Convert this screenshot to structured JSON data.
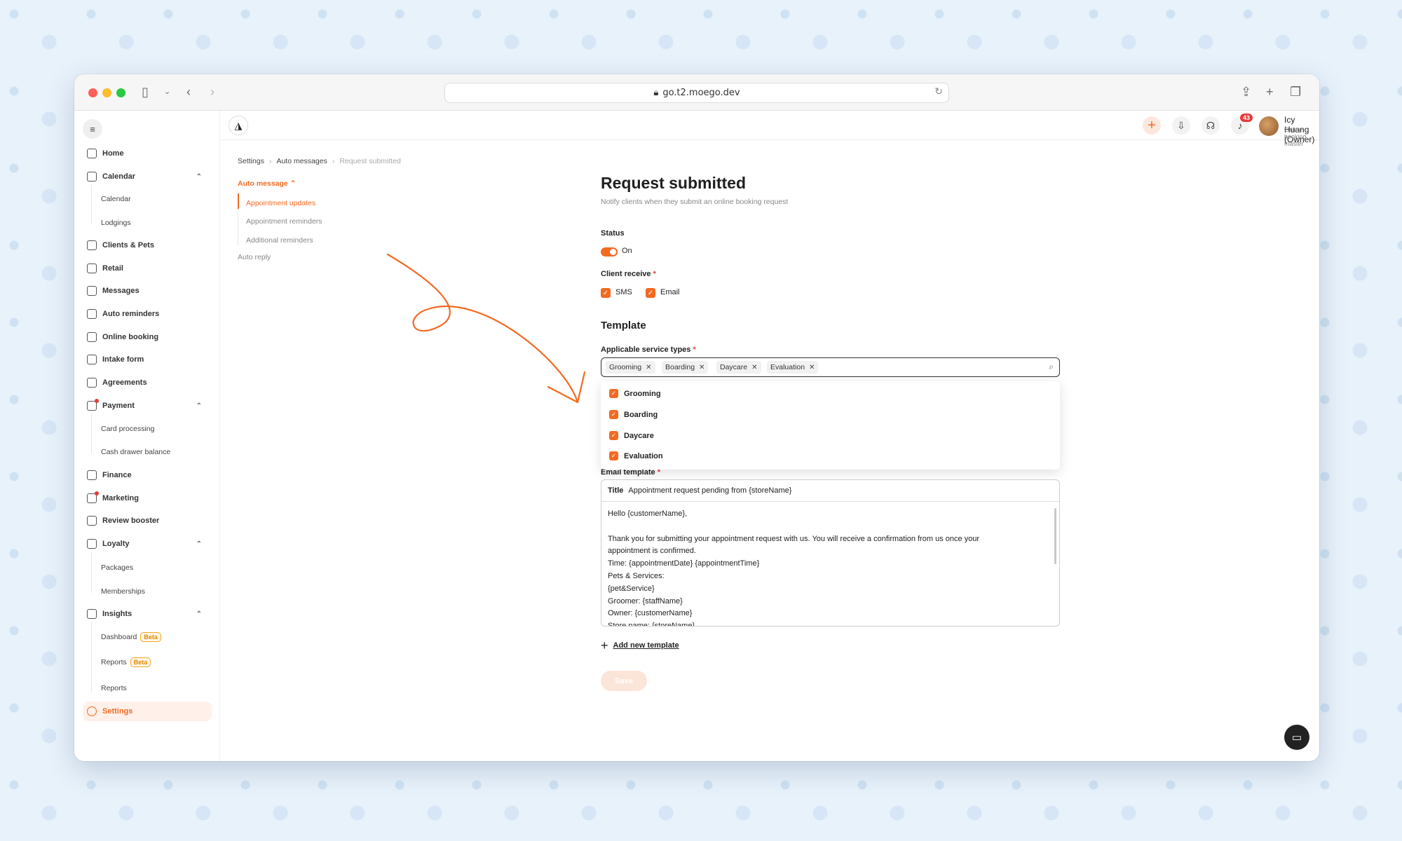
{
  "browser": {
    "url": "go.t2.moego.dev"
  },
  "header": {
    "notifications_count": "43",
    "user_name": "Icy Huang (Owner)",
    "user_role": "Online booking master"
  },
  "sidebar": {
    "items": [
      {
        "label": "Home"
      },
      {
        "label": "Calendar"
      },
      {
        "label": "Clients & Pets"
      },
      {
        "label": "Retail"
      },
      {
        "label": "Messages"
      },
      {
        "label": "Auto reminders"
      },
      {
        "label": "Online booking"
      },
      {
        "label": "Intake form"
      },
      {
        "label": "Agreements"
      },
      {
        "label": "Payment"
      },
      {
        "label": "Finance"
      },
      {
        "label": "Marketing"
      },
      {
        "label": "Review booster"
      },
      {
        "label": "Loyalty"
      },
      {
        "label": "Insights"
      },
      {
        "label": "Settings"
      }
    ],
    "calendar_sub": [
      "Calendar",
      "Lodgings"
    ],
    "payment_sub": [
      "Card processing",
      "Cash drawer balance"
    ],
    "loyalty_sub": [
      "Packages",
      "Memberships"
    ],
    "insights_sub": [
      "Dashboard",
      "Reports",
      "Reports"
    ],
    "beta_label": "Beta"
  },
  "breadcrumb": {
    "items": [
      "Settings",
      "Auto messages",
      "Request submitted"
    ],
    "separator": "›"
  },
  "subnav": {
    "head": "Auto message",
    "items": [
      "Appointment updates",
      "Appointment reminders",
      "Additional reminders"
    ],
    "auto_reply": "Auto reply"
  },
  "main": {
    "title": "Request submitted",
    "subtitle": "Notify clients when they submit an online booking request",
    "status_label": "Status",
    "status_value": "On",
    "client_receive_label": "Client receive",
    "client_receive_options": [
      "SMS",
      "Email"
    ],
    "template_heading": "Template",
    "service_types_label": "Applicable service types",
    "service_tags": [
      "Grooming",
      "Boarding",
      "Daycare",
      "Evaluation"
    ],
    "dropdown_options": [
      "Grooming",
      "Boarding",
      "Daycare",
      "Evaluation"
    ],
    "email_template_label": "Email template",
    "email_title_label": "Title",
    "email_title_value": "Appointment request pending from {storeName}",
    "email_body": [
      "Hello {customerName},",
      "",
      "Thank you for submitting your appointment request with us. You will receive a confirmation from us once your",
      "appointment is confirmed.",
      "Time: {appointmentDate} {appointmentTime}",
      "Pets & Services:",
      "{pet&Service}",
      "Groomer: {staffName}",
      "Owner: {customerName}",
      "Store name: {storeName}"
    ],
    "add_template_label": "Add new template",
    "save_label": "Save"
  },
  "colors": {
    "accent": "#f26a21",
    "required": "#e8393a"
  }
}
